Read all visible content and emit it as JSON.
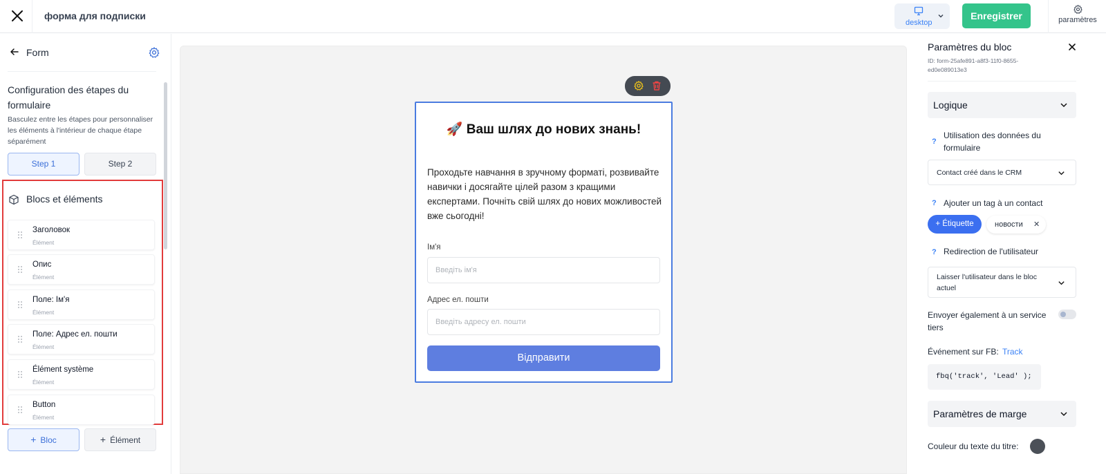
{
  "topbar": {
    "title": "форма для подписки",
    "device_label": "desktop",
    "save_label": "Enregistrer",
    "settings_label": "paramètres"
  },
  "left_panel": {
    "back_title": "Form",
    "steps_heading": "Configuration des étapes du formulaire",
    "steps_description": "Basculez entre les étapes pour personnaliser les éléments à l'intérieur de chaque étape séparément",
    "steps": [
      {
        "label": "Step 1",
        "active": true
      },
      {
        "label": "Step 2",
        "active": false
      }
    ],
    "blocks_heading": "Blocs et éléments",
    "elements": [
      {
        "title": "Заголовок",
        "subtitle": "Élément"
      },
      {
        "title": "Опис",
        "subtitle": "Élément"
      },
      {
        "title": "Поле: Ім'я",
        "subtitle": "Élément"
      },
      {
        "title": "Поле: Адрес ел. пошти",
        "subtitle": "Élément"
      },
      {
        "title": "Élément système",
        "subtitle": "Élément"
      },
      {
        "title": "Button",
        "subtitle": "Élément"
      }
    ],
    "add_bloc_label": "Bloc",
    "add_element_label": "Élément"
  },
  "form_preview": {
    "title": "🚀 Ваш шлях до нових знань!",
    "description": "Проходьте навчання в зручному форматі, розвивайте навички і досягайте цілей разом з кращими експертами. Почніть свій шлях до нових можливостей вже сьогодні!",
    "fields": [
      {
        "label": "Ім'я",
        "placeholder": "Введіть ім'я"
      },
      {
        "label": "Адрес ел. пошти",
        "placeholder": "Введіть адресу ел. пошти"
      }
    ],
    "submit_label": "Відправити"
  },
  "right_panel": {
    "title": "Paramètres du bloc",
    "block_id": "ID: form-25afe891-a8f3-11f0-8655-ed0e089013e3",
    "logic_section": "Logique",
    "form_data_usage_label": "Utilisation des données du formulaire",
    "form_data_usage_value": "Contact créé dans le CRM",
    "add_tag_label": "Ajouter un tag à un contact",
    "add_tag_button": "Étiquette",
    "tags": [
      "новости"
    ],
    "redirect_label": "Redirection de l'utilisateur",
    "redirect_value": "Laisser l'utilisateur dans le bloc actuel",
    "third_party_label": "Envoyer également à un service tiers",
    "third_party_enabled": false,
    "fb_event_label": "Événement sur FB:",
    "fb_event_value": "Track",
    "fb_code": "fbq('track', 'Lead' );",
    "margin_section": "Paramètres de marge",
    "title_color_label": "Couleur du texte du titre:",
    "title_color": "#4b5058"
  },
  "colors": {
    "accent_blue": "#3b6fd8",
    "save_green": "#34c48b",
    "selection_red": "#e23b3b",
    "submit_blue": "#5e7ee0"
  }
}
